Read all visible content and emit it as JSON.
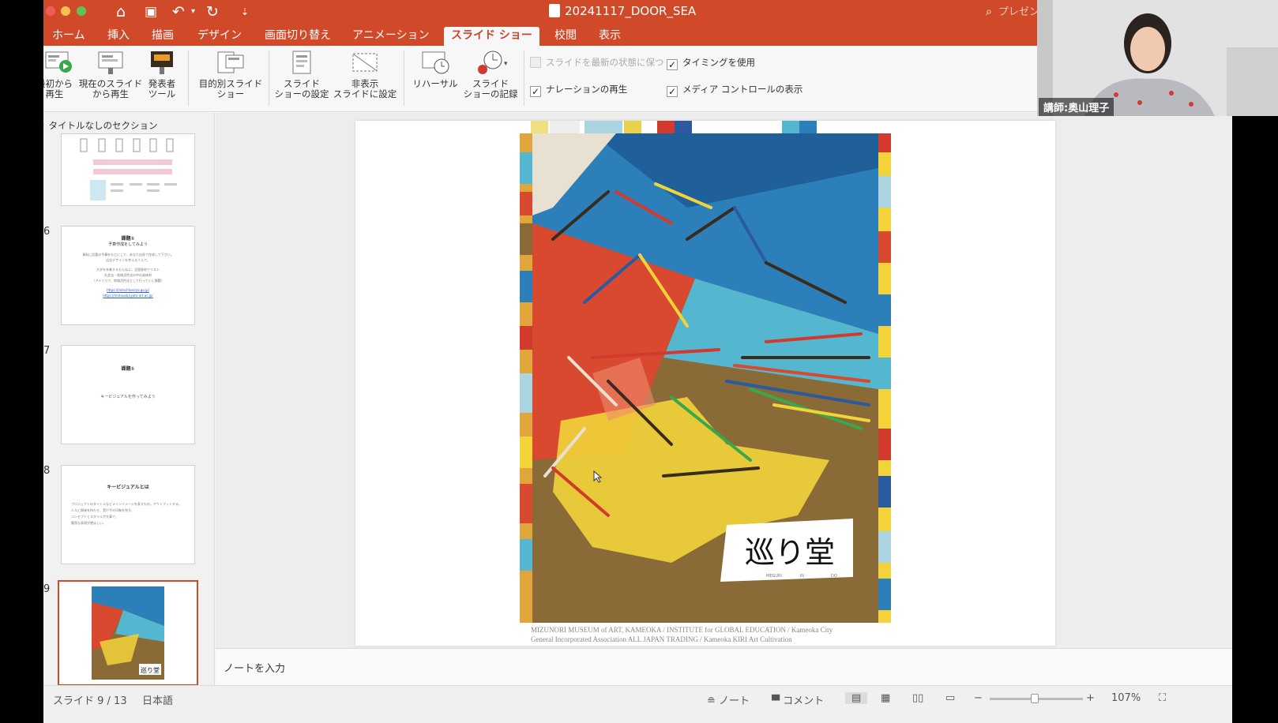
{
  "window": {
    "title": "20241117_DOOR_SEA",
    "search_placeholder": "プレゼンテ"
  },
  "tabs": [
    {
      "label": "ホーム"
    },
    {
      "label": "挿入"
    },
    {
      "label": "描画"
    },
    {
      "label": "デザイン"
    },
    {
      "label": "画面切り替え"
    },
    {
      "label": "アニメーション"
    },
    {
      "label": "スライド ショー",
      "active": true
    },
    {
      "label": "校閲"
    },
    {
      "label": "表示"
    }
  ],
  "ribbon": {
    "from_start": "最初から\n再生",
    "from_current": "現在のスライド\nから再生",
    "presenter_tools": "発表者\nツール",
    "custom_show": "目的別スライド\nショー",
    "setup_show": "スライド\nショーの設定",
    "hide_slide": "非表示\nスライドに設定",
    "rehearse": "リハーサル",
    "record_show": "スライド\nショーの記録",
    "keep_updated": {
      "label": "スライドを最新の状態に保つ",
      "checked": false,
      "enabled": false
    },
    "play_narrations": {
      "label": "ナレーションの再生",
      "checked": true
    },
    "use_timings": {
      "label": "タイミングを使用",
      "checked": true
    },
    "show_media_controls": {
      "label": "メディア コントロールの表示",
      "checked": true
    }
  },
  "thumbnails": {
    "section": "タイトルなしのセクション",
    "items": [
      {
        "num": ""
      },
      {
        "num": "6",
        "title": "課題①",
        "subtitle": "予算作成をしてみよう",
        "body": [
          "資料に記載の予算をもとにして、あなた自身で作成して下さい。",
          "広告デザインを考えるうえで、",
          "大学を卒業するもんねよ。全国各地でリスト",
          "社会法・地域活性化の中の具体的",
          "（アメリカで、地域活性化として行っていく課題）"
        ],
        "links": [
          "https://inimcf-kenryo.go.jp/",
          "https://mirlasub.kyoto-art.ac.jp/"
        ]
      },
      {
        "num": "7",
        "title": "課題①",
        "body": "キービジュアルを作ってみよう"
      },
      {
        "num": "8",
        "title": "キービジュアルとは",
        "body": [
          "プロジェクトのタイトルなどメインイメージを表すもの。アウトプットする。",
          "人々に興味を持たせ、受け手の印象を残す。",
          "コンセプトとスタイルが大事で、",
          "簡潔な表現が望ましい。"
        ]
      },
      {
        "num": "9",
        "selected": true
      }
    ]
  },
  "slide": {
    "logo_text": "巡り堂",
    "logo_sub": [
      "MEGURI",
      "RI",
      "DO"
    ],
    "credits": [
      "MIZUNORI MUSEUM of ART, KAMEOKA / INSTITUTE for GLOBAL EDUCATION / Kameoka City",
      "General Incorporated Association ALL JAPAN TRADING / Kameoka KIRI Art Cultivation"
    ]
  },
  "notes_placeholder": "ノートを入力",
  "status": {
    "slide_count": "スライド 9 / 13",
    "language": "日本語",
    "notes_btn": "ノート",
    "comments_btn": "コメント",
    "zoom": "107%"
  },
  "webcam": {
    "presenter_label": "講師:奥山理子"
  },
  "colors": {
    "accent": "#d04a2a",
    "ribbon_bg": "#f7f7f7",
    "selected_thumb": "#d04a2a"
  }
}
